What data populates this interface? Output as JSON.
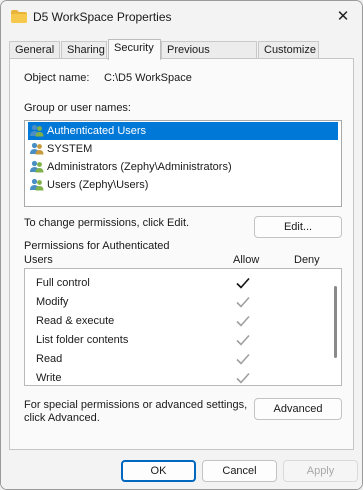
{
  "window": {
    "title": "D5 WorkSpace Properties",
    "close_glyph": "✕"
  },
  "tabs": [
    {
      "label": "General",
      "active": false
    },
    {
      "label": "Sharing",
      "active": false
    },
    {
      "label": "Security",
      "active": true
    },
    {
      "label": "Previous Versions",
      "active": false
    },
    {
      "label": "Customize",
      "active": false
    }
  ],
  "security": {
    "object_name_label": "Object name:",
    "object_name_value": "C:\\D5 WorkSpace",
    "groups_label": "Group or user names:",
    "groups": [
      {
        "label": "Authenticated Users",
        "selected": true,
        "icon": "user-group-icon"
      },
      {
        "label": "SYSTEM",
        "selected": false,
        "icon": "user-group-icon"
      },
      {
        "label": "Administrators (Zephy\\Administrators)",
        "selected": false,
        "icon": "user-group-icon"
      },
      {
        "label": "Users (Zephy\\Users)",
        "selected": false,
        "icon": "user-group-icon"
      }
    ],
    "change_hint": "To change permissions, click Edit.",
    "edit_button": "Edit...",
    "permissions_label_line1": "Permissions for Authenticated",
    "permissions_label_line2": "Users",
    "allow_header": "Allow",
    "deny_header": "Deny",
    "permissions": [
      {
        "name": "Full control",
        "allow": "explicit"
      },
      {
        "name": "Modify",
        "allow": "inherited"
      },
      {
        "name": "Read & execute",
        "allow": "inherited"
      },
      {
        "name": "List folder contents",
        "allow": "inherited"
      },
      {
        "name": "Read",
        "allow": "inherited"
      },
      {
        "name": "Write",
        "allow": "inherited"
      }
    ],
    "advanced_hint_line1": "For special permissions or advanced settings,",
    "advanced_hint_line2": "click Advanced.",
    "advanced_button": "Advanced"
  },
  "footer": {
    "ok_label": "OK",
    "cancel_label": "Cancel",
    "apply_label": "Apply"
  },
  "colors": {
    "selection": "#0078d7",
    "explicit_check": "#111111",
    "inherited_check": "#a0a0a0",
    "primary_border": "#0067c0"
  }
}
